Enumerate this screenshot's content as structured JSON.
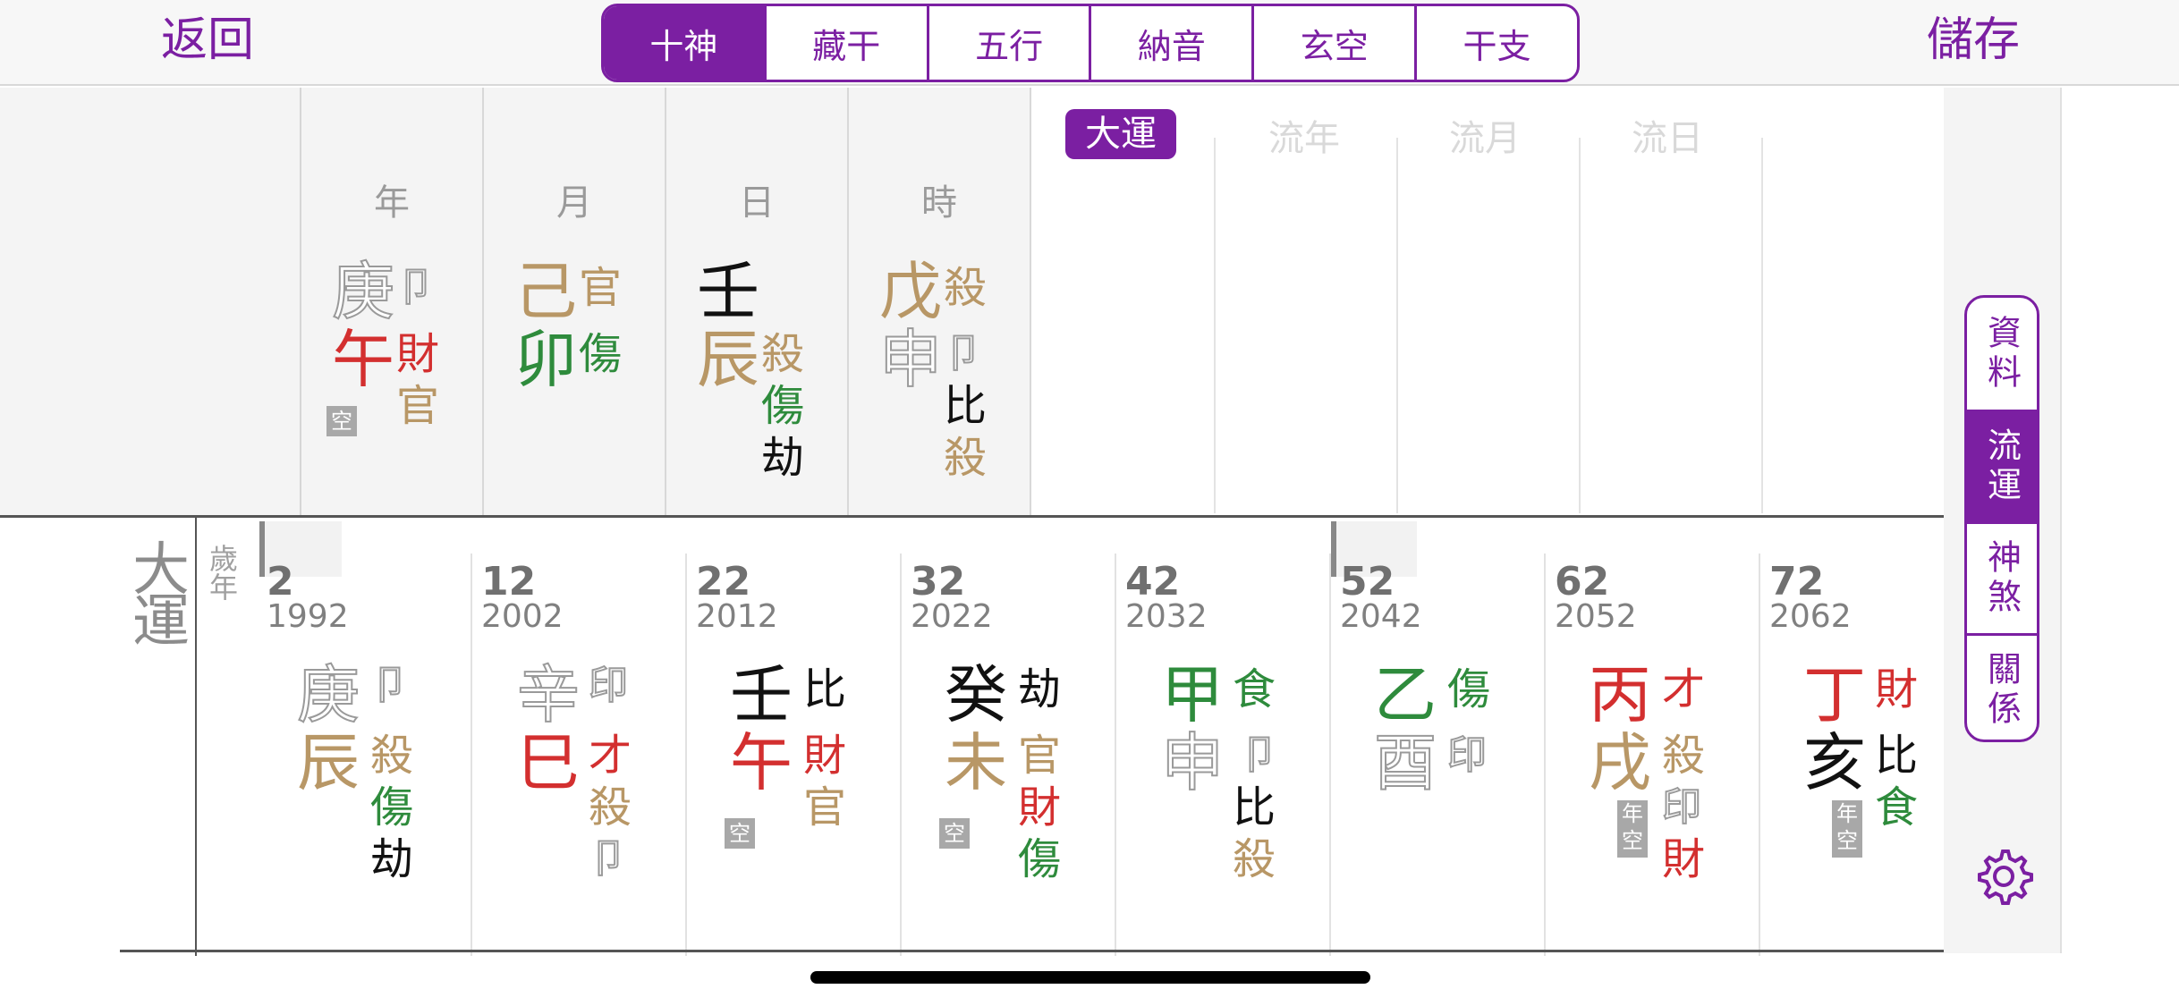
{
  "topbar": {
    "back_label": "返回",
    "save_label": "儲存",
    "tabs": [
      "十神",
      "藏干",
      "五行",
      "納音",
      "玄空",
      "干支"
    ],
    "active_tab": "十神"
  },
  "pillars": [
    {
      "header": "年",
      "stem": "庚",
      "branch": "午",
      "kong": "空",
      "side": [
        "卩",
        "財",
        "官"
      ]
    },
    {
      "header": "月",
      "stem": "己",
      "branch": "卯",
      "side": [
        "官",
        "傷"
      ]
    },
    {
      "header": "日",
      "stem": "壬",
      "branch": "辰",
      "side": [
        "殺",
        "傷",
        "劫"
      ]
    },
    {
      "header": "時",
      "stem": "戊",
      "branch": "申",
      "side": [
        "殺",
        "卩",
        "比",
        "殺"
      ]
    }
  ],
  "luck_tabs": [
    "大運",
    "流年",
    "流月",
    "流日"
  ],
  "decade": {
    "label": "大運",
    "year_age_label": "歲年",
    "columns": [
      {
        "age": "2",
        "year": "1992",
        "stem": "庚",
        "branch": "辰",
        "side": [
          "卩",
          "殺",
          "傷",
          "劫"
        ]
      },
      {
        "age": "12",
        "year": "2002",
        "stem": "辛",
        "branch": "巳",
        "side": [
          "印",
          "才",
          "殺",
          "卩"
        ]
      },
      {
        "age": "22",
        "year": "2012",
        "stem": "壬",
        "branch": "午",
        "kong": "空",
        "side": [
          "比",
          "財",
          "官"
        ]
      },
      {
        "age": "32",
        "year": "2022",
        "stem": "癸",
        "branch": "未",
        "kong": "空",
        "side": [
          "劫",
          "官",
          "財",
          "傷"
        ]
      },
      {
        "age": "42",
        "year": "2032",
        "stem": "甲",
        "branch": "申",
        "side": [
          "食",
          "卩",
          "比",
          "殺"
        ]
      },
      {
        "age": "52",
        "year": "2042",
        "stem": "乙",
        "branch": "酉",
        "side": [
          "傷",
          "印"
        ]
      },
      {
        "age": "62",
        "year": "2052",
        "stem": "丙",
        "branch": "戌",
        "kong": "年空",
        "side": [
          "才",
          "殺",
          "印",
          "財"
        ]
      },
      {
        "age": "72",
        "year": "2062",
        "stem": "丁",
        "branch": "亥",
        "kong": "年空",
        "side": [
          "財",
          "比",
          "食"
        ]
      }
    ]
  },
  "side_menu": [
    "資料",
    "流運",
    "神煞",
    "關係"
  ],
  "side_menu_active": "流運",
  "colors": {
    "accent": "#7b1fa2",
    "red": "#d32f2f",
    "tan": "#b89766",
    "green": "#2e8b3c",
    "gray": "#9a9a9a"
  },
  "icons": {
    "settings": "gear-icon"
  }
}
